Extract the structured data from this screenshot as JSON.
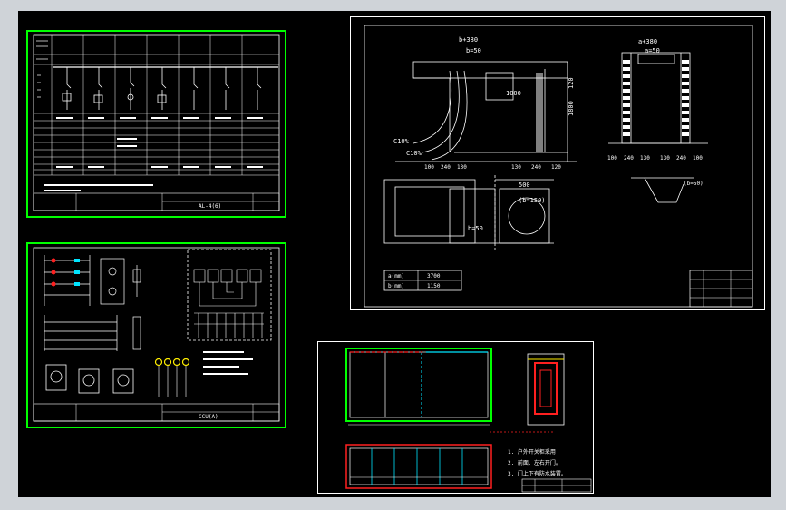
{
  "colors": {
    "background": "#000000",
    "frame": "#00ff00",
    "line": "#ffffff",
    "red": "#ff2020",
    "cyan": "#00e5ff",
    "yellow": "#ffee00"
  },
  "sheet1": {
    "title_label": "AL-4(6)"
  },
  "sheet2": {
    "title_label": "CCU(A)"
  },
  "sheet3": {
    "dim_top_left": "b+380",
    "dim_b50": "b=50",
    "dim_a380": "a+380",
    "dim_a50": "a=50",
    "dim_1000": "1000",
    "dim_1800": "1800",
    "dim_120": "120",
    "dim_c10_1": "C10%",
    "dim_c10_2": "C10%",
    "dim_b50_plan": "b=50",
    "dim_500": "500",
    "dim_b150": "(b=150)",
    "dim_b50_detail": "(b=50)",
    "table": {
      "a_label": "a(mm)",
      "a_value": "3700",
      "b_label": "b(mm)",
      "b_value": "1150"
    },
    "bottom_dims": [
      "100",
      "240",
      "130",
      "130",
      "240",
      "120"
    ],
    "right_dims": [
      "100",
      "240",
      "130",
      "130",
      "240",
      "100"
    ]
  },
  "sheet4": {
    "notes": [
      "1. 户外开关柜采用",
      "2. 前面、左右开门。",
      "3. 门上下有防水装置。"
    ]
  }
}
